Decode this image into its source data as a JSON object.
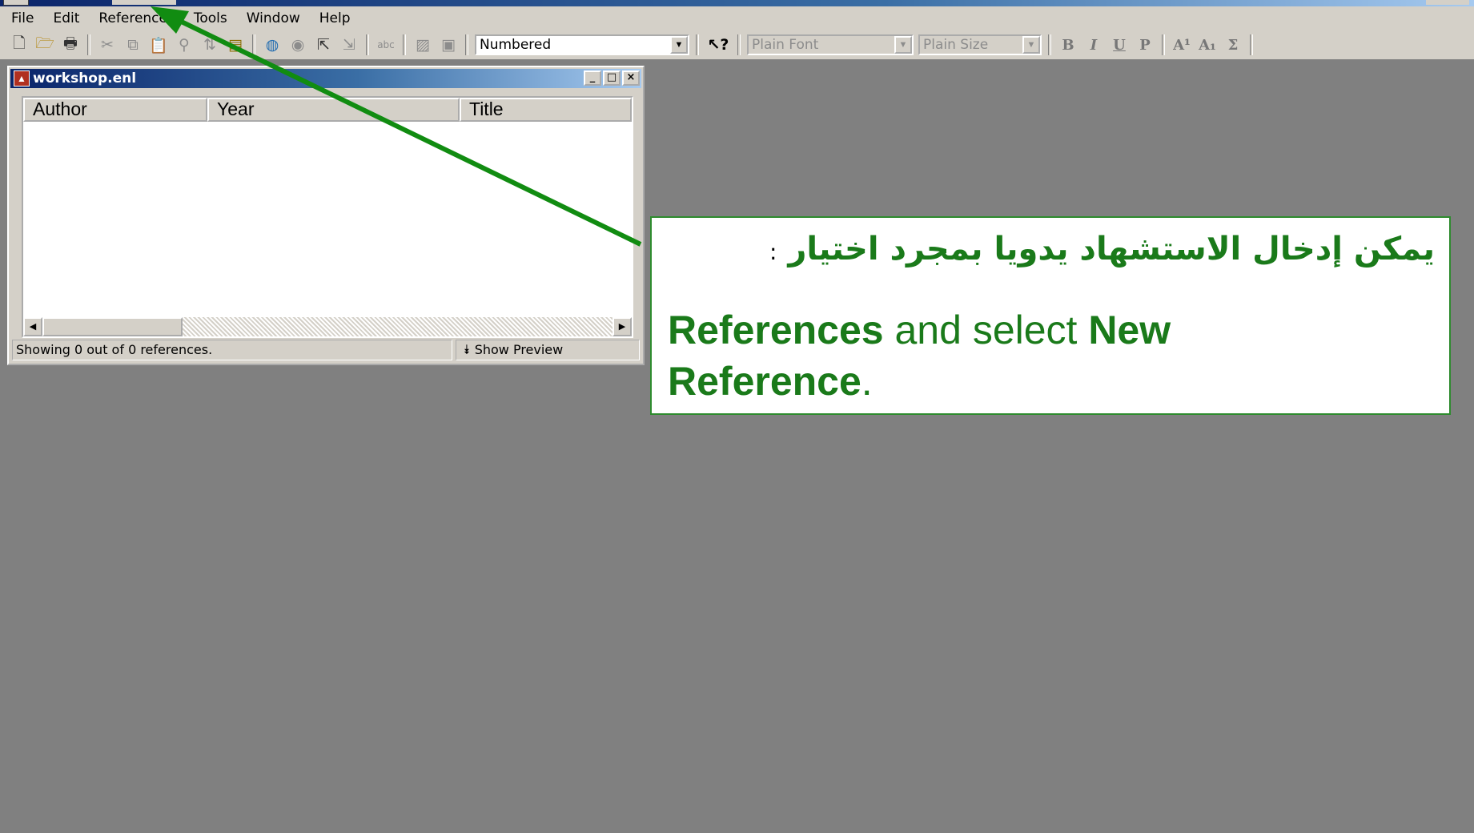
{
  "menubar": {
    "items": [
      {
        "name": "menu-file",
        "label": "File"
      },
      {
        "name": "menu-edit",
        "label": "Edit"
      },
      {
        "name": "menu-references",
        "label": "References"
      },
      {
        "name": "menu-tools",
        "label": "Tools"
      },
      {
        "name": "menu-window",
        "label": "Window"
      },
      {
        "name": "menu-help",
        "label": "Help"
      }
    ]
  },
  "toolbar": {
    "style_select": "Numbered",
    "font_select": "Plain Font",
    "size_select": "Plain Size",
    "icons": [
      "new-document-icon",
      "open-folder-icon",
      "print-icon",
      "cut-icon",
      "copy-icon",
      "paste-icon",
      "find-icon",
      "sort-icon",
      "layers-icon",
      "globe-icon",
      "search-online-icon",
      "export-icon",
      "import-icon",
      "spell-check-icon",
      "figure-icon",
      "image-icon",
      "help-pointer-icon",
      "bold-icon",
      "italic-icon",
      "underline-icon",
      "plain-icon",
      "superscript-icon",
      "subscript-icon",
      "sigma-icon"
    ]
  },
  "library": {
    "title": "workshop.enl",
    "columns": [
      "Author",
      "Year",
      "Title"
    ],
    "status": "Showing 0 out of 0 references.",
    "preview_label": "Show Preview"
  },
  "callout": {
    "arabic": "يمكن إدخال الاستشهاد يدويا بمجرد اختيار",
    "arabic_colon": ":",
    "en_part1": "References",
    "en_part2": " and select ",
    "en_part3": "New Reference",
    "en_part4": "."
  },
  "colors": {
    "accent": "#1a7a1a",
    "arrow": "#118c11"
  }
}
